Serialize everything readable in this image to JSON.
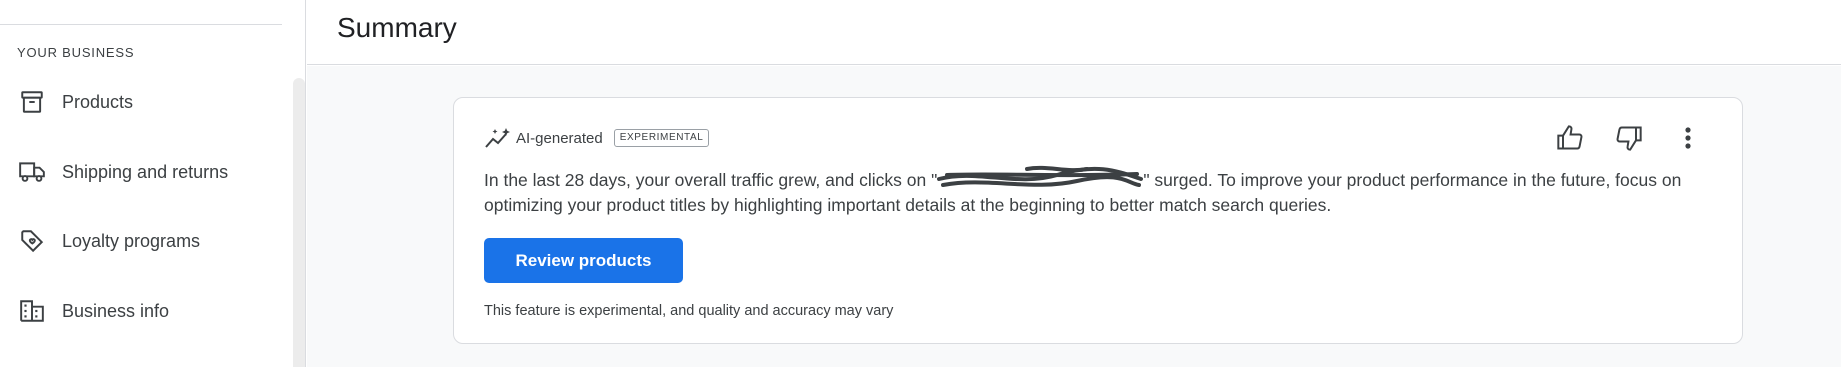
{
  "sidebar": {
    "section_heading": "YOUR BUSINESS",
    "items": [
      {
        "label": "Products",
        "icon": "archive-box-icon"
      },
      {
        "label": "Shipping and returns",
        "icon": "truck-icon"
      },
      {
        "label": "Loyalty programs",
        "icon": "tag-heart-icon"
      },
      {
        "label": "Business info",
        "icon": "building-icon"
      }
    ]
  },
  "header": {
    "title": "Summary"
  },
  "card": {
    "ai_label": "AI-generated",
    "badge": "EXPERIMENTAL",
    "summary_before": "In the last 28 days, your overall traffic grew, and clicks on \"",
    "summary_after": "\" surged. To improve your product performance in the future, focus on optimizing your product titles by highlighting important details at the beginning to better match search queries.",
    "cta_label": "Review products",
    "disclaimer": "This feature is experimental, and quality and accuracy may vary",
    "actions": [
      "thumb-up-icon",
      "thumb-down-icon",
      "more-vert-icon"
    ]
  },
  "colors": {
    "accent": "#1a73e8",
    "text": "#3c4043",
    "divider": "#dadce0",
    "main_bg": "#f8f9fa"
  }
}
